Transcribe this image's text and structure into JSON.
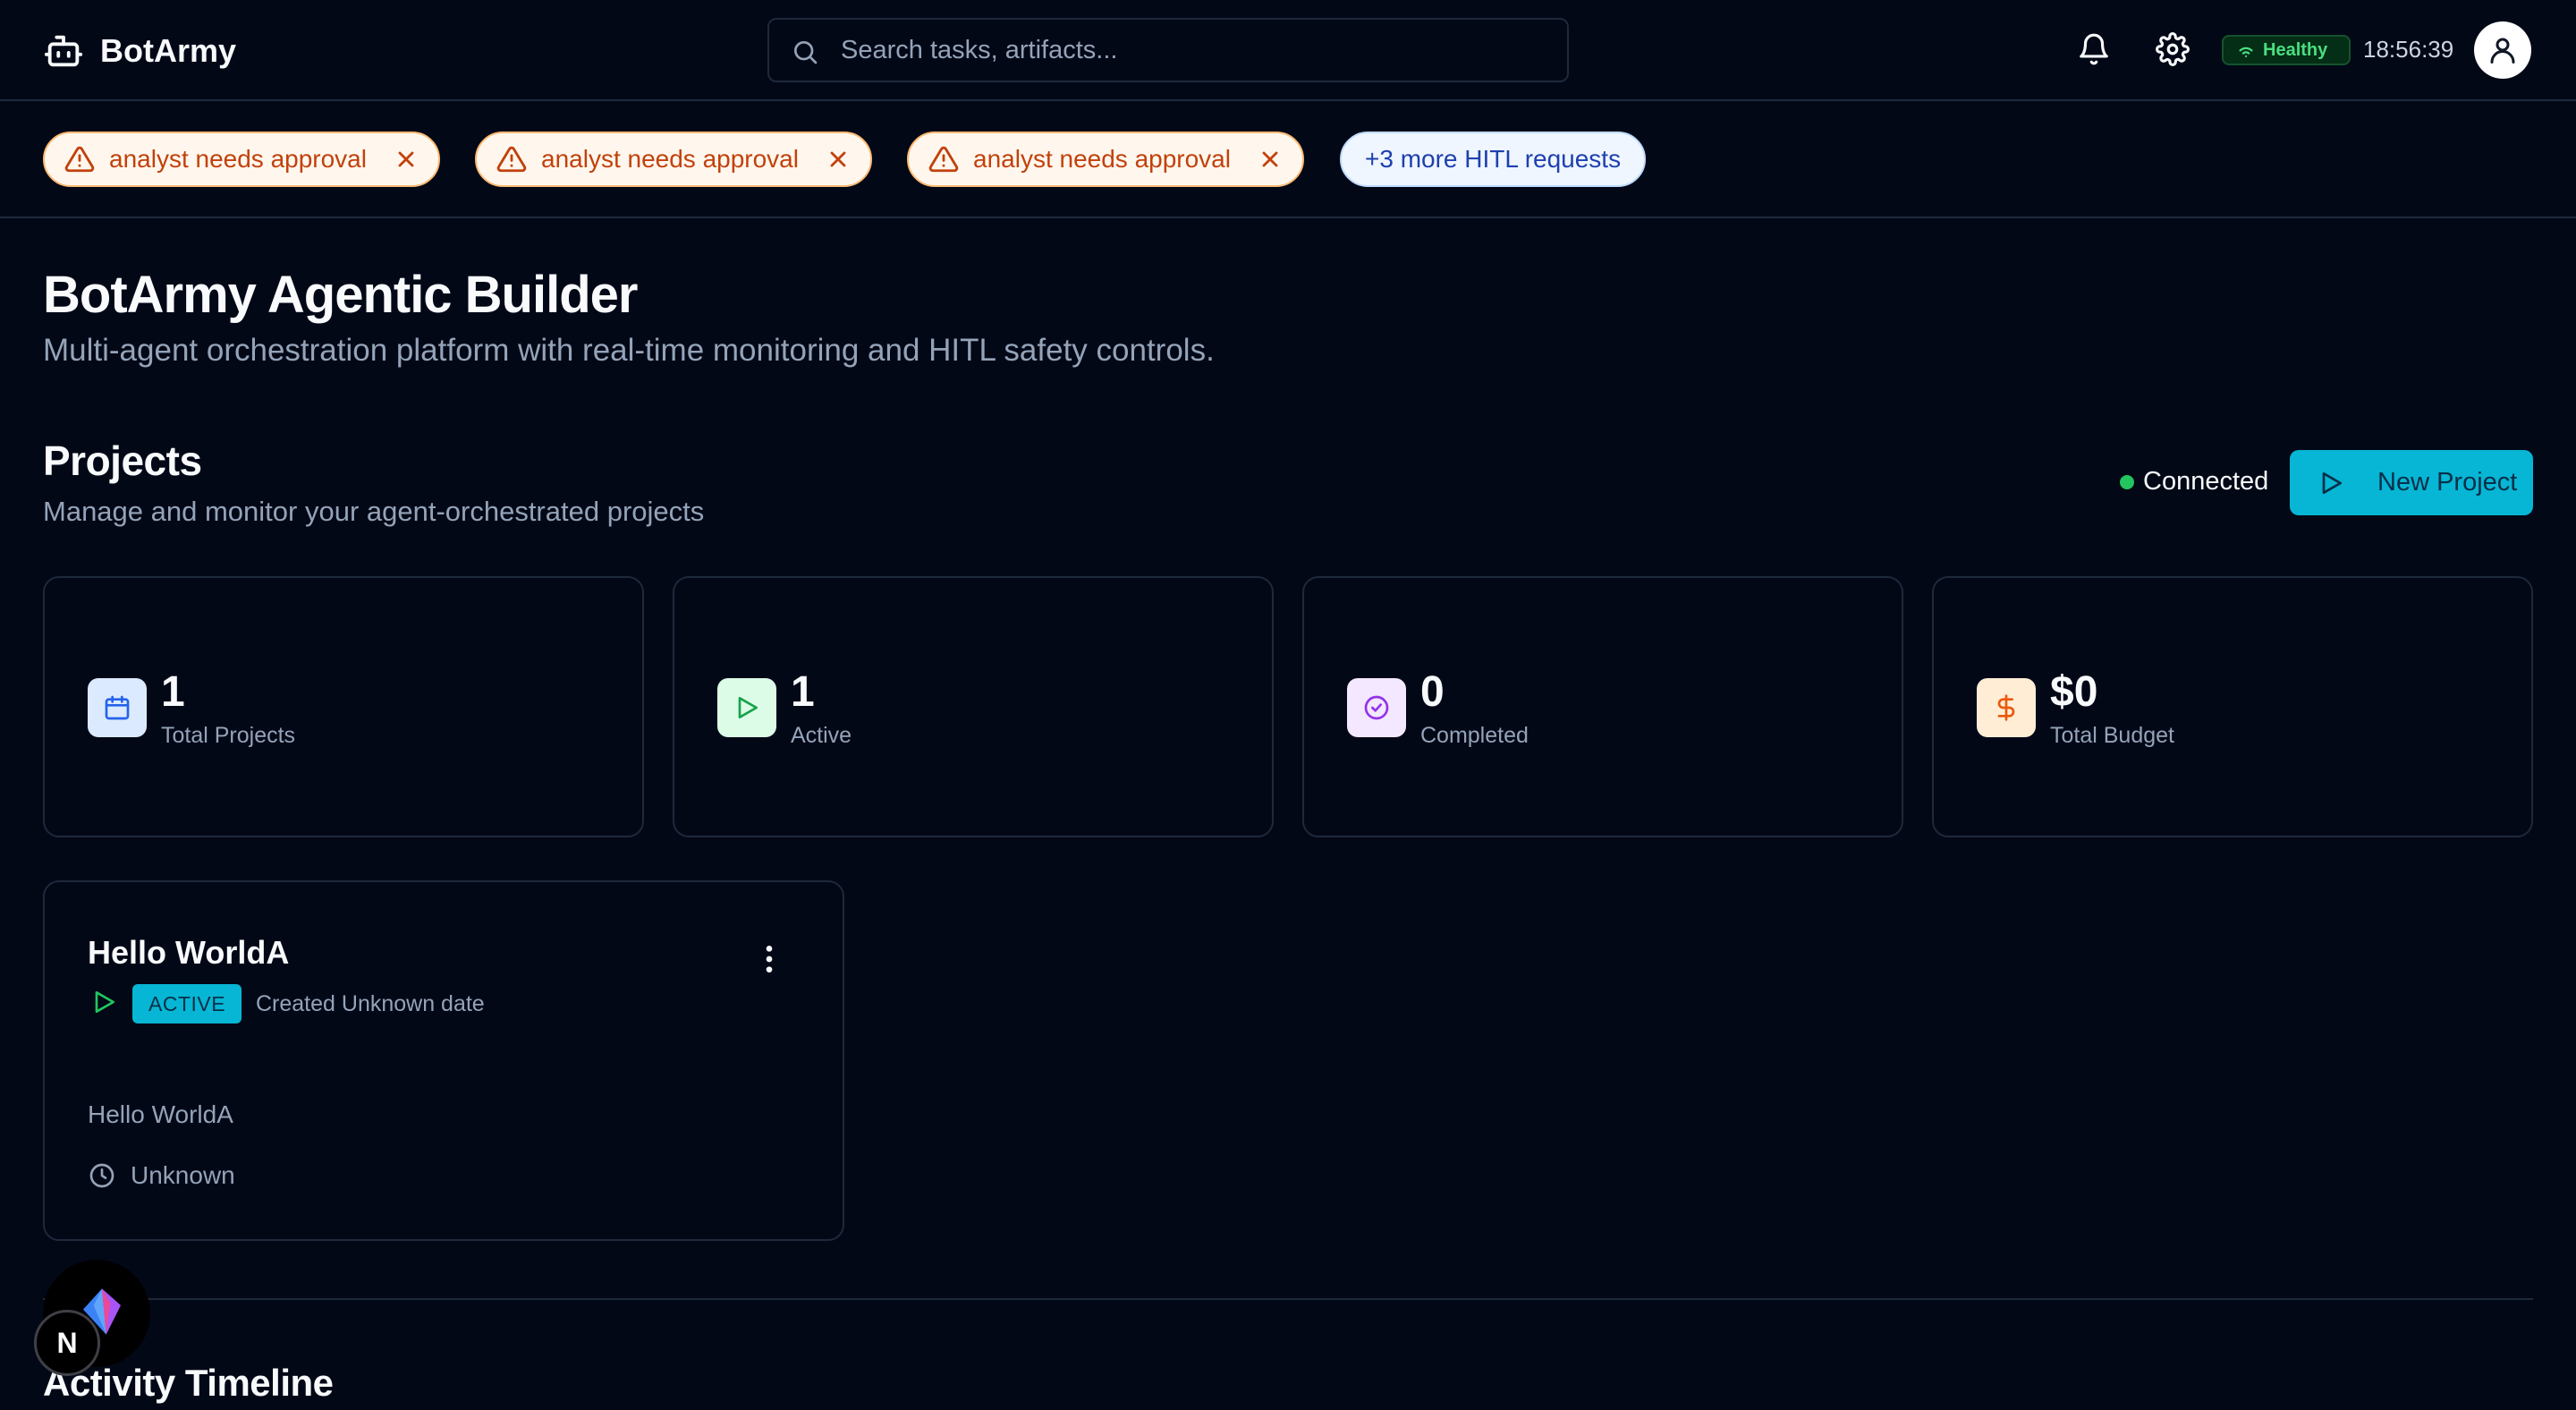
{
  "header": {
    "app_name": "BotArmy",
    "search_placeholder": "Search tasks, artifacts...",
    "health_status": "Healthy",
    "time": "18:56:39",
    "icons": [
      "robot-logo-icon",
      "search-icon",
      "bell-icon",
      "gear-icon",
      "wifi-icon",
      "user-icon"
    ]
  },
  "hitl": {
    "requests": [
      {
        "label": "analyst needs approval"
      },
      {
        "label": "analyst needs approval"
      },
      {
        "label": "analyst needs approval"
      }
    ],
    "more_label": "+3 more HITL requests"
  },
  "hero": {
    "title": "BotArmy Agentic Builder",
    "subtitle": "Multi-agent orchestration platform with real-time monitoring and HITL safety controls."
  },
  "projects": {
    "title": "Projects",
    "subtitle": "Manage and monitor your agent-orchestrated projects",
    "connection_status": "Connected",
    "new_button_label": "New Project",
    "stats": [
      {
        "value": "1",
        "label": "Total Projects",
        "icon": "calendar-icon",
        "color": "#2563eb",
        "bg": "#dbeafe"
      },
      {
        "value": "1",
        "label": "Active",
        "icon": "play-icon",
        "color": "#16a34a",
        "bg": "#dcfce7"
      },
      {
        "value": "0",
        "label": "Completed",
        "icon": "check-circle-icon",
        "color": "#9333ea",
        "bg": "#f3e8ff"
      },
      {
        "value": "$0",
        "label": "Total Budget",
        "icon": "dollar-icon",
        "color": "#ea580c",
        "bg": "#ffedd5"
      }
    ],
    "cards": [
      {
        "name": "Hello WorldA",
        "status": "ACTIVE",
        "created": "Created Unknown date",
        "description": "Hello WorldA",
        "time": "Unknown"
      }
    ]
  },
  "timeline": {
    "title": "Activity Timeline"
  },
  "dev": {
    "next_label": "N"
  },
  "colors": {
    "background": "#030817",
    "accent": "#06b6d4",
    "warning": "#c2410c",
    "success": "#22c55e"
  }
}
